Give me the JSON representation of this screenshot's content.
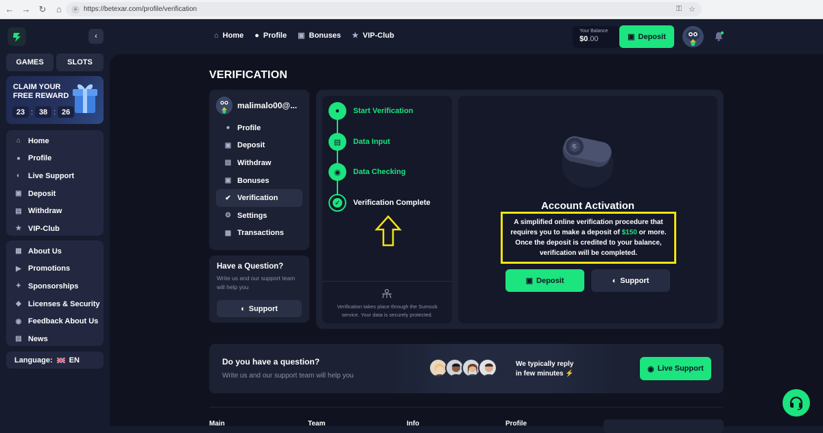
{
  "browser": {
    "url": "https://betexar.com/profile/verification"
  },
  "sidebar": {
    "tabs": [
      "GAMES",
      "SLOTS"
    ],
    "promo": {
      "title": "CLAIM YOUR FREE REWARD",
      "timer": [
        "23",
        "38",
        "26"
      ]
    },
    "main_items": [
      {
        "label": "Home",
        "icon": "home-icon"
      },
      {
        "label": "Profile",
        "icon": "user-icon"
      },
      {
        "label": "Live Support",
        "icon": "headset-icon"
      },
      {
        "label": "Deposit",
        "icon": "wallet-icon"
      },
      {
        "label": "Withdraw",
        "icon": "withdraw-icon"
      },
      {
        "label": "VIP-Club",
        "icon": "star-icon"
      }
    ],
    "info_items": [
      {
        "label": "About Us",
        "icon": "book-icon"
      },
      {
        "label": "Promotions",
        "icon": "megaphone-icon"
      },
      {
        "label": "Sponsorships",
        "icon": "handshake-icon"
      },
      {
        "label": "Licenses & Security",
        "icon": "shield-icon"
      },
      {
        "label": "Feedback About Us",
        "icon": "feedback-icon"
      },
      {
        "label": "News",
        "icon": "news-icon"
      }
    ],
    "language": {
      "label": "Language:",
      "value": "EN",
      "flag": "uk-flag"
    }
  },
  "header": {
    "nav": [
      {
        "label": "Home",
        "icon": "home-icon"
      },
      {
        "label": "Profile",
        "icon": "user-icon"
      },
      {
        "label": "Bonuses",
        "icon": "gift-icon"
      },
      {
        "label": "VIP-Club",
        "icon": "star-icon"
      }
    ],
    "balance_label": "Your Balance",
    "balance_main": "$0",
    "balance_cents": ".00",
    "deposit_label": "Deposit"
  },
  "page": {
    "title": "VERIFICATION"
  },
  "profile_card": {
    "username": "malimalo00@...",
    "menu": [
      {
        "label": "Profile",
        "active": false
      },
      {
        "label": "Deposit",
        "active": false
      },
      {
        "label": "Withdraw",
        "active": false
      },
      {
        "label": "Bonuses",
        "active": false
      },
      {
        "label": "Verification",
        "active": true
      },
      {
        "label": "Settings",
        "active": false
      },
      {
        "label": "Transactions",
        "active": false
      }
    ]
  },
  "question_card": {
    "title": "Have a Question?",
    "text": "Write us and our support team will help you",
    "support_label": "Support"
  },
  "steps": {
    "items": [
      {
        "label": "Start Verification",
        "done": true
      },
      {
        "label": "Data Input",
        "done": true
      },
      {
        "label": "Data Checking",
        "done": true
      },
      {
        "label": "Verification Complete",
        "done": false
      }
    ],
    "note": "Verification takes place through the Sumsub service. Your data is securely protected."
  },
  "activation": {
    "title": "Account Activation",
    "text_before": "A simplified online verification procedure that requires you to make a deposit of",
    "amount": "$150",
    "text_after": "or more. Once the deposit is credited to your balance, verification will be completed.",
    "deposit_label": "Deposit",
    "support_label": "Support"
  },
  "help_bar": {
    "title": "Do you have a question?",
    "subtitle": "Write us and our support team will help you",
    "reply_line1": "We typically reply",
    "reply_line2": "in few minutes",
    "live_support_label": "Live Support"
  },
  "footer": {
    "columns": [
      "Main",
      "Team",
      "Info",
      "Profile"
    ]
  },
  "colors": {
    "accent": "#1ce47e",
    "highlight": "#f5e512",
    "background": "#10131f"
  }
}
